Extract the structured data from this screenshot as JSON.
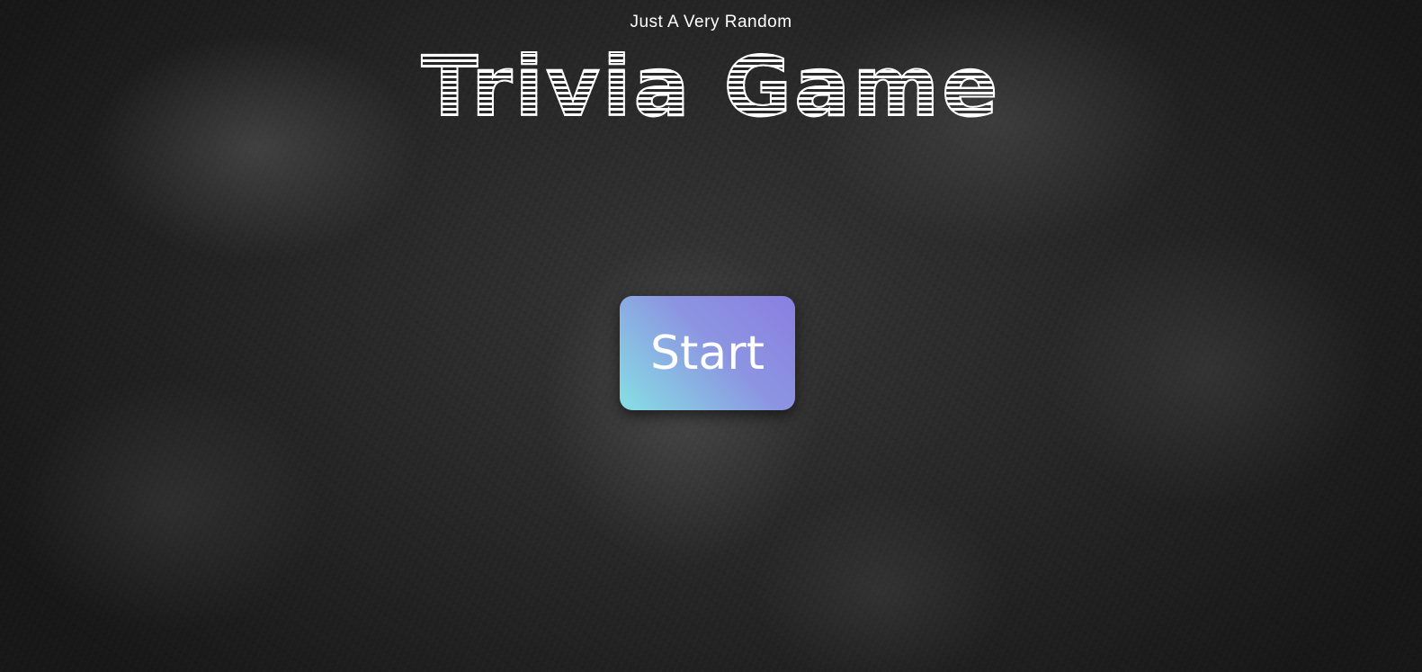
{
  "header": {
    "subtitle": "Just A Very Random",
    "title": "Trivia Game"
  },
  "main": {
    "start_label": "Start"
  },
  "colors": {
    "button_gradient_start": "#86e0e4",
    "button_gradient_end": "#8a7fe0",
    "text": "#ffffff",
    "background": "#2b2b2b"
  }
}
